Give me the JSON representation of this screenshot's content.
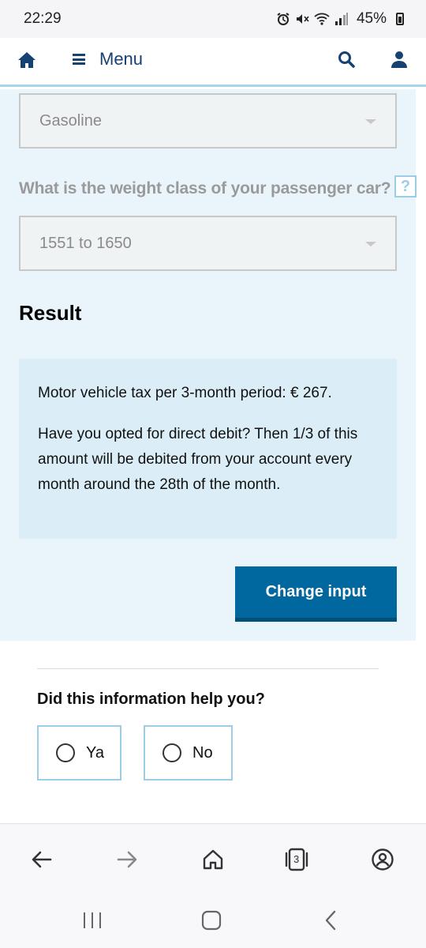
{
  "status": {
    "time": "22:29",
    "battery": "45%",
    "icons": [
      "alarm-icon",
      "mute-icon",
      "wifi-icon",
      "signal-icon",
      "battery-icon"
    ]
  },
  "header": {
    "menu_label": "Menu"
  },
  "form": {
    "fuel_value": "Gasoline",
    "weight_question": "What is the weight class of your passenger car?",
    "help_label": "?",
    "weight_value": "1551 to 1650"
  },
  "result": {
    "title": "Result",
    "tax_line": "Motor vehicle tax per 3-month period: € 267.",
    "debit_line": "Have you opted for direct debit? Then 1/3 of this amount will be debited from your account every month around the 28th of the month.",
    "change_button": "Change input"
  },
  "feedback": {
    "question": "Did this information help you?",
    "options": [
      "Ya",
      "No"
    ]
  },
  "browser": {
    "tabs_count": "3"
  },
  "colors": {
    "brand": "#154273",
    "button": "#00689e",
    "panel": "#eaf5fb",
    "result_box": "#dbeef8",
    "accent_border": "#9ccde6"
  }
}
